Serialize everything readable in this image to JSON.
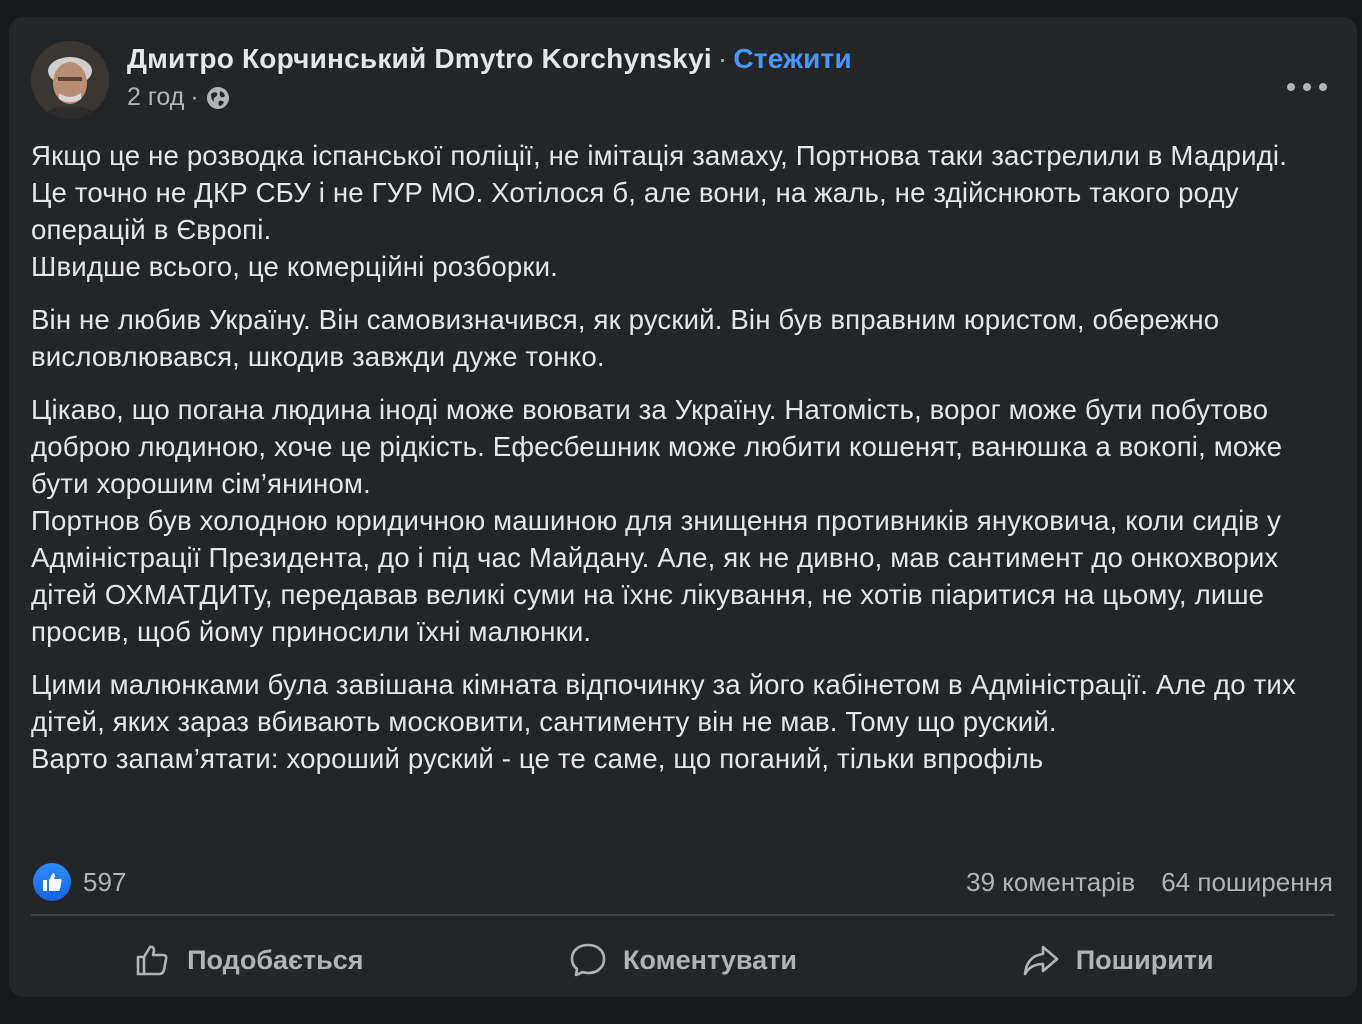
{
  "post": {
    "author_name": "Дмитро Корчинський Dmytro Korchynskyi",
    "separator": "·",
    "follow_label": "Стежити",
    "time": "2 год",
    "meta_separator": "·",
    "privacy_icon": "globe-icon",
    "more_icon": "more-horizontal-icon",
    "paragraphs": [
      "Якщо це не розводка іспанської поліції, не імітація замаху, Портнова таки застрелили в Мадриді.\nЦе точно не ДКР СБУ і не ГУР МО. Хотілося б, але вони, на жаль, не здійснюють такого роду операцій в Європі.\nШвидше всього, це комерційні розборки.",
      "Він не любив Україну. Він самовизначився, як руский. Він був вправним юристом, обережно висловлювався, шкодив завжди дуже тонко.",
      "Цікаво, що погана людина іноді може воювати за Україну. Натомість, ворог може бути побутово доброю людиною, хоче це рідкість. Ефесбешник може любити кошенят, ванюшка а вокопі, може бути хорошим сім’янином.\nПортнов був холодною юридичною машиною для знищення противників януковича, коли сидів у Адміністрації Президента, до і під час Майдану. Але, як не дивно, мав сантимент до онкохворих дітей ОХМАТДИТу, передавав великі суми на їхнє лікування, не хотів піаритися на цьому, лише просив, щоб йому приносили їхні малюнки.",
      "Цими малюнками була завішана кімната відпочинку за його кабінетом в Адміністрації. Але до тих дітей, яких зараз вбивають московити, сантименту він не мав.  Тому що руский.\nВарто запам’ятати: хороший руский - це те саме, що поганий, тільки впрофіль"
    ]
  },
  "stats": {
    "reaction_icon": "like-reaction-icon",
    "likes": "597",
    "comments": "39 коментарів",
    "shares": "64 поширення"
  },
  "actions": {
    "like_label": "Подобається",
    "like_icon": "thumbs-up-icon",
    "comment_label": "Коментувати",
    "comment_icon": "comment-bubble-icon",
    "share_label": "Поширити",
    "share_icon": "share-arrow-icon"
  },
  "colors": {
    "background": "#18191a",
    "card": "#242526",
    "text_primary": "#e4e6eb",
    "text_secondary": "#b0b3b8",
    "link": "#4599ff",
    "like_blue": "#1877f2"
  }
}
